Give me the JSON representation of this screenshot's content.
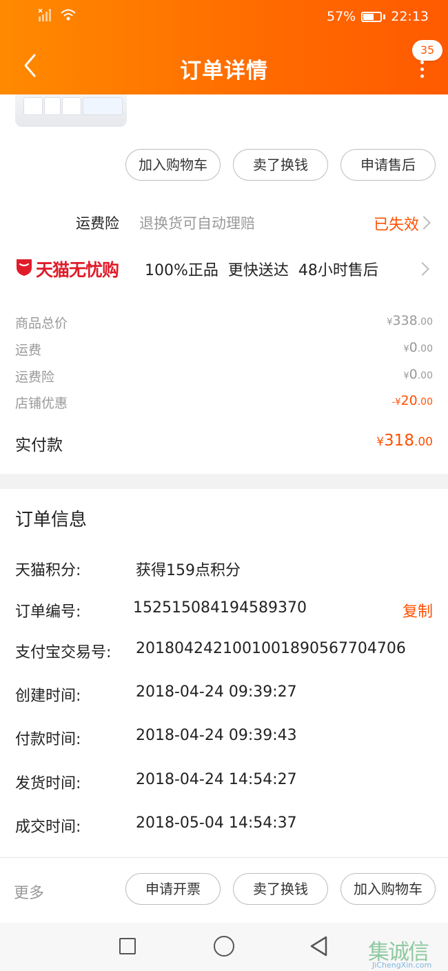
{
  "status_bar": {
    "battery": "57%",
    "time": "22:13",
    "signal_icon": "signal-icon",
    "wifi_icon": "wifi-icon",
    "battery_level": 0.57
  },
  "header": {
    "title": "订单详情",
    "badge_count": "35",
    "back_icon": "chevron-left-icon",
    "more_icon": "more-vertical-icon"
  },
  "action_buttons_top": [
    "加入购物车",
    "卖了换钱",
    "申请售后"
  ],
  "insurance": {
    "label": "运费险",
    "description": "退换货可自动理赔",
    "status": "已失效"
  },
  "tmall_guarantee": {
    "brand": "天猫无忧购",
    "features": [
      "100%正品",
      "更快送达",
      "48小时售后"
    ]
  },
  "price_breakdown": [
    {
      "label": "商品总价",
      "prefix": "¥",
      "integer": "338",
      "decimal": ".00"
    },
    {
      "label": "运费",
      "prefix": "¥",
      "integer": "0",
      "decimal": ".00"
    },
    {
      "label": "运费险",
      "prefix": "¥",
      "integer": "0",
      "decimal": ".00"
    },
    {
      "label": "店铺优惠",
      "prefix": "-¥",
      "integer": "20",
      "decimal": ".00"
    }
  ],
  "total": {
    "label": "实付款",
    "prefix": "¥",
    "integer": "318",
    "decimal": ".00"
  },
  "order_info": {
    "title": "订单信息",
    "copy_label": "复制",
    "rows": [
      {
        "label": "天猫积分:",
        "value": "获得159点积分"
      },
      {
        "label": "订单编号:",
        "value": "152515084194589370"
      },
      {
        "label": "支付宝交易号:",
        "value": "2018042421001001890567704706"
      },
      {
        "label": "创建时间:",
        "value": "2018-04-24 09:39:27"
      },
      {
        "label": "付款时间:",
        "value": "2018-04-24 09:39:43"
      },
      {
        "label": "发货时间:",
        "value": "2018-04-24 14:54:27"
      },
      {
        "label": "成交时间:",
        "value": "2018-05-04 14:54:37"
      }
    ]
  },
  "footer": {
    "more_label": "更多",
    "buttons": [
      "申请开票",
      "卖了换钱",
      "加入购物车"
    ]
  },
  "watermark": {
    "chars": "集诚信",
    "sub": "JiChengXin.com"
  },
  "colors": {
    "accent": "#ff5000",
    "header_start": "#ff8a00",
    "header_end": "#ff5a00",
    "tmall_red": "#e01c2a"
  }
}
